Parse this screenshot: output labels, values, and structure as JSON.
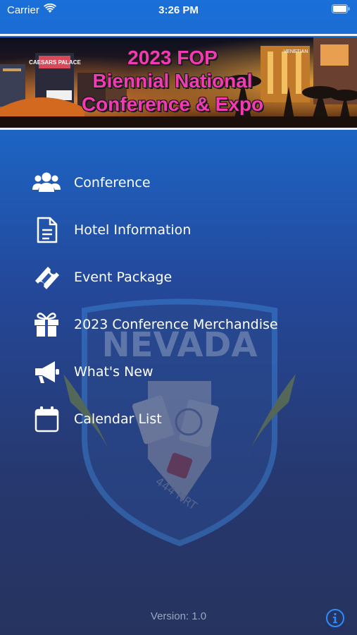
{
  "status_bar": {
    "carrier": "Carrier",
    "time": "3:26 PM"
  },
  "banner": {
    "title_line1": "2023 FOP",
    "title_line2": "Biennial National",
    "title_line3": "Conference & Expo",
    "caption_left": "CAESARS PALACE",
    "caption_right": "VENETIAN"
  },
  "watermark": {
    "text": "NEVADA",
    "lodge": "444 NRT"
  },
  "menu": {
    "items": [
      {
        "label": "Conference",
        "icon": "people-group-icon"
      },
      {
        "label": "Hotel Information",
        "icon": "document-icon"
      },
      {
        "label": "Event Package",
        "icon": "ticket-icon"
      },
      {
        "label": "2023 Conference Merchandise",
        "icon": "gift-icon"
      },
      {
        "label": "What's New",
        "icon": "megaphone-icon"
      },
      {
        "label": "Calendar List",
        "icon": "calendar-icon"
      }
    ]
  },
  "footer": {
    "version": "Version: 1.0",
    "info_icon": "info-icon"
  },
  "colors": {
    "banner_title": "#f23ab3",
    "background_top": "#1a6fd8",
    "background_bottom": "#26335f",
    "version_text": "#9aa6c2",
    "info": "#2f8cff"
  }
}
